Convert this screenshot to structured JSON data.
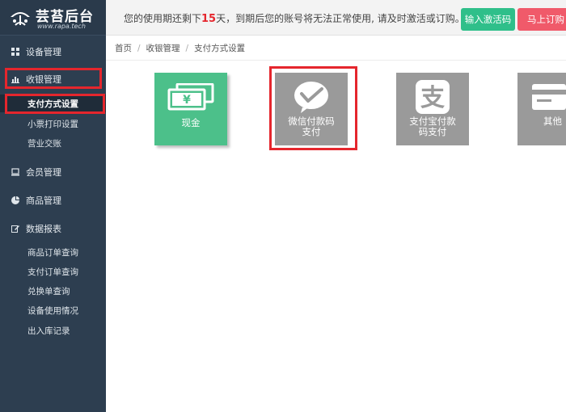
{
  "app": {
    "logo_title": "芸苔后台",
    "logo_sub": "www.rapa.tech"
  },
  "sidebar": {
    "items": [
      {
        "label": "设备管理",
        "icon": "grid-icon"
      },
      {
        "label": "收银管理",
        "icon": "bar-chart-icon",
        "highlighted": true
      },
      {
        "label": "会员管理",
        "icon": "laptop-icon"
      },
      {
        "label": "商品管理",
        "icon": "pie-chart-icon"
      },
      {
        "label": "数据报表",
        "icon": "edit-icon"
      }
    ],
    "cashier_sub": [
      {
        "label": "支付方式设置",
        "active": true
      },
      {
        "label": "小票打印设置"
      },
      {
        "label": "营业交账"
      }
    ],
    "report_sub": [
      {
        "label": "商品订单查询"
      },
      {
        "label": "支付订单查询"
      },
      {
        "label": "兑换单查询"
      },
      {
        "label": "设备使用情况"
      },
      {
        "label": "出入库记录"
      }
    ]
  },
  "topbar": {
    "notice_pre": "您的使用期还剩下",
    "days": "15",
    "notice_post": "天，到期后您的账号将无法正常使用, 请及时激活或订购。",
    "activate_label": "输入激活码",
    "order_label": "马上订购"
  },
  "breadcrumb": [
    "首页",
    "收银管理",
    "支付方式设置"
  ],
  "payments": [
    {
      "label": "现金",
      "icon": "cash-icon",
      "color": "#4cc08a",
      "enabled": true
    },
    {
      "label": "微信付款码\n支付",
      "icon": "wechat-pay-icon",
      "color": "#9a9a9a",
      "selected": true
    },
    {
      "label": "支付宝付款\n码支付",
      "icon": "alipay-icon",
      "color": "#9a9a9a"
    },
    {
      "label": "其他",
      "icon": "card-icon",
      "color": "#9a9a9a"
    }
  ],
  "colors": {
    "sidebar_bg": "#2d3e50",
    "highlight": "#e5262d",
    "activate_btn": "#2fbf8a",
    "order_btn": "#f05a6a"
  }
}
